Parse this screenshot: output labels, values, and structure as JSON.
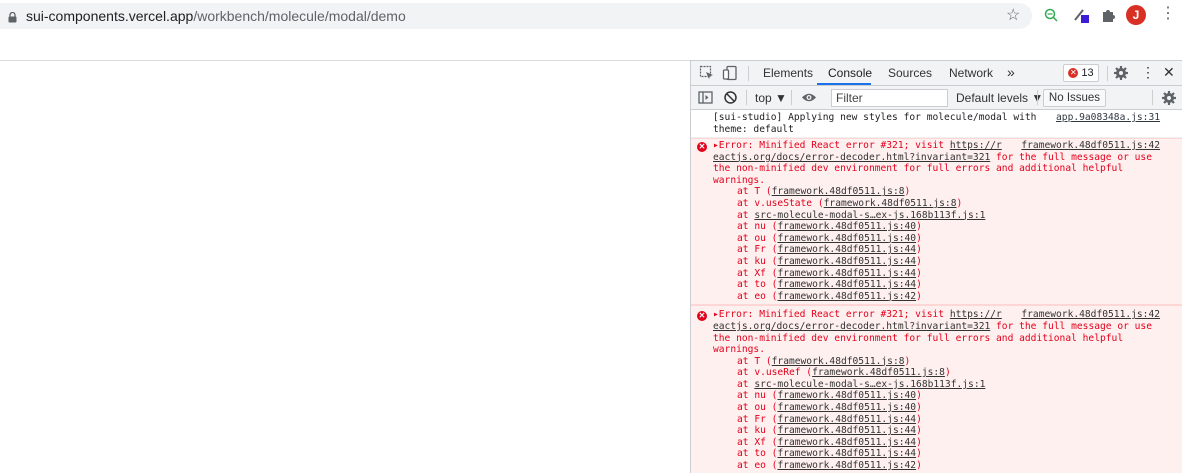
{
  "browser": {
    "url_host": "sui-components.vercel.app",
    "url_path": "/workbench/molecule/modal/demo",
    "avatar_letter": "J",
    "icons": [
      "lock-icon",
      "star-icon",
      "extension-icon",
      "extension-icon",
      "puzzle-icon",
      "avatar",
      "more-menu-icon"
    ]
  },
  "devtools": {
    "tabs": [
      "Elements",
      "Console",
      "Sources",
      "Network"
    ],
    "active_tab": "Console",
    "more_tabs": "»",
    "error_count": "13",
    "context": "top ▼",
    "filter_placeholder": "Filter",
    "levels": "Default levels ▼",
    "issues": "No Issues"
  },
  "console": {
    "log": {
      "line1": "[sui-studio] Applying new styles for molecule/modal with",
      "line2": "theme: default",
      "source": "app.9a08348a.js:31"
    },
    "errors": [
      {
        "head_text": "Error: Minified React error #321; visit ",
        "head_link": "https://r",
        "source": "framework.48df0511.js:42",
        "line2_link": "eactjs.org/docs/error-decoder.html?invariant=321",
        "line2_text": " for the full message or use",
        "line3": "the non-minified dev environment for full errors and additional helpful",
        "line4": "warnings.",
        "stack": [
          {
            "fn": "at T (",
            "loc": "framework.48df0511.js:8",
            "end": ")"
          },
          {
            "fn": "at v.useState (",
            "loc": "framework.48df0511.js:8",
            "end": ")"
          },
          {
            "fn": "at ",
            "loc": "src-molecule-modal-s…ex-js.168b113f.js:1",
            "end": ""
          },
          {
            "fn": "at nu (",
            "loc": "framework.48df0511.js:40",
            "end": ")"
          },
          {
            "fn": "at ou (",
            "loc": "framework.48df0511.js:40",
            "end": ")"
          },
          {
            "fn": "at Fr (",
            "loc": "framework.48df0511.js:44",
            "end": ")"
          },
          {
            "fn": "at ku (",
            "loc": "framework.48df0511.js:44",
            "end": ")"
          },
          {
            "fn": "at Xf (",
            "loc": "framework.48df0511.js:44",
            "end": ")"
          },
          {
            "fn": "at to (",
            "loc": "framework.48df0511.js:44",
            "end": ")"
          },
          {
            "fn": "at eo (",
            "loc": "framework.48df0511.js:42",
            "end": ")"
          }
        ]
      },
      {
        "head_text": "Error: Minified React error #321; visit ",
        "head_link": "https://r",
        "source": "framework.48df0511.js:42",
        "line2_link": "eactjs.org/docs/error-decoder.html?invariant=321",
        "line2_text": " for the full message or use",
        "line3": "the non-minified dev environment for full errors and additional helpful",
        "line4": "warnings.",
        "stack": [
          {
            "fn": "at T (",
            "loc": "framework.48df0511.js:8",
            "end": ")"
          },
          {
            "fn": "at v.useRef (",
            "loc": "framework.48df0511.js:8",
            "end": ")"
          },
          {
            "fn": "at ",
            "loc": "src-molecule-modal-s…ex-js.168b113f.js:1",
            "end": ""
          },
          {
            "fn": "at nu (",
            "loc": "framework.48df0511.js:40",
            "end": ")"
          },
          {
            "fn": "at ou (",
            "loc": "framework.48df0511.js:40",
            "end": ")"
          },
          {
            "fn": "at Fr (",
            "loc": "framework.48df0511.js:44",
            "end": ")"
          },
          {
            "fn": "at ku (",
            "loc": "framework.48df0511.js:44",
            "end": ")"
          },
          {
            "fn": "at Xf (",
            "loc": "framework.48df0511.js:44",
            "end": ")"
          },
          {
            "fn": "at to (",
            "loc": "framework.48df0511.js:44",
            "end": ")"
          },
          {
            "fn": "at eo (",
            "loc": "framework.48df0511.js:42",
            "end": ")"
          }
        ]
      }
    ]
  },
  "colors": {
    "error_text": "#e3001b",
    "error_bg": "#fff0f0",
    "tab_active": "#1a73e8",
    "avatar": "#d93025"
  }
}
